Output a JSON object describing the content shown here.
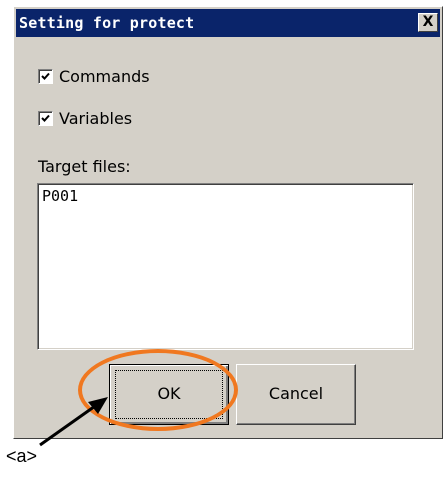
{
  "window": {
    "title": "Setting for protect",
    "close_glyph": "X"
  },
  "options": {
    "commands": {
      "label": "Commands",
      "checked": true
    },
    "variables": {
      "label": "Variables",
      "checked": true
    }
  },
  "target_files": {
    "label": "Target files:",
    "value": "P001"
  },
  "buttons": {
    "ok_label": "OK",
    "cancel_label": "Cancel"
  },
  "annotation": {
    "callout_label": "<a>",
    "highlight_color": "#f07820"
  },
  "colors": {
    "title_bar": "#0a246a",
    "dialog_face": "#d4d0c8"
  }
}
